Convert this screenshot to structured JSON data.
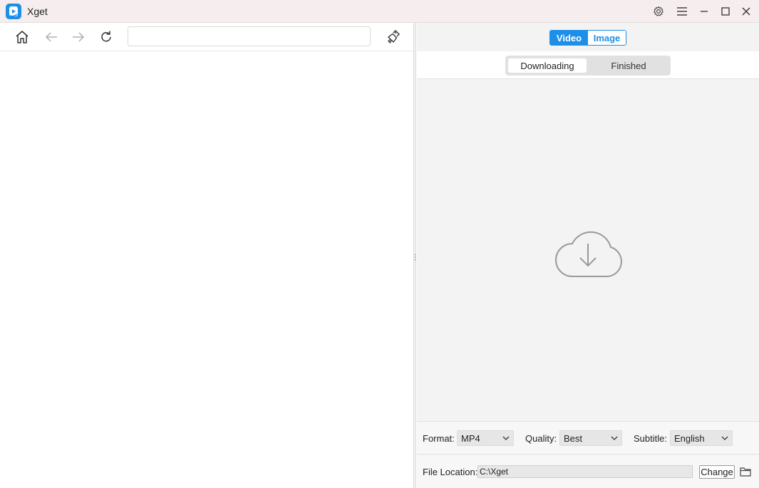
{
  "app": {
    "title": "Xget"
  },
  "browser": {
    "url_value": "",
    "url_placeholder": ""
  },
  "downloader": {
    "type_tabs": [
      {
        "label": "Video",
        "active": true
      },
      {
        "label": "Image",
        "active": false
      }
    ],
    "status_tabs": [
      {
        "label": "Downloading",
        "active": true
      },
      {
        "label": "Finished",
        "active": false
      }
    ]
  },
  "options": {
    "format_label": "Format:",
    "format_value": "MP4",
    "quality_label": "Quality:",
    "quality_value": "Best",
    "subtitle_label": "Subtitle:",
    "subtitle_value": "English"
  },
  "location": {
    "label": "File Location:",
    "path": "C:\\Xget",
    "change_label": "Change"
  },
  "colors": {
    "accent": "#1e8fe8",
    "titlebar": "#f6eeee",
    "panel": "#f3f3f3"
  },
  "icons": [
    "app-logo-icon",
    "settings-icon",
    "menu-icon",
    "minimize-icon",
    "maximize-icon",
    "close-icon",
    "home-icon",
    "back-arrow-icon",
    "forward-arrow-icon",
    "refresh-icon",
    "clear-broom-icon",
    "cloud-download-icon",
    "chevron-down-icon",
    "folder-icon"
  ]
}
